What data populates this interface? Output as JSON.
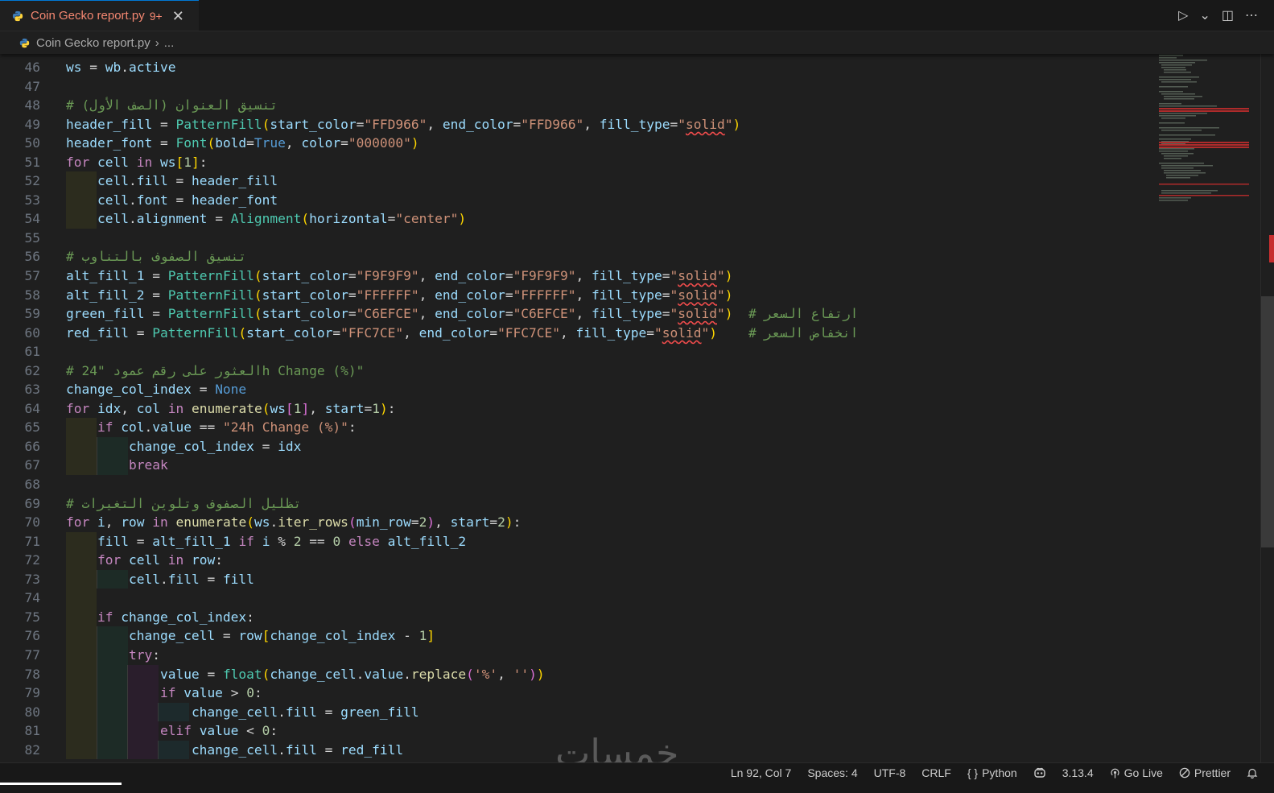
{
  "tab": {
    "filename": "Coin Gecko report.py",
    "badge": "9+",
    "close": "✕"
  },
  "breadcrumb": {
    "file": "Coin Gecko report.py",
    "chevron": "›",
    "more": "..."
  },
  "actions": {
    "run": "▷",
    "run_dropdown": "⌄",
    "split": "◫",
    "more": "⋯"
  },
  "code_lines": [
    "46",
    "47",
    "48",
    "49",
    "50",
    "51",
    "52",
    "53",
    "54",
    "55",
    "56",
    "57",
    "58",
    "59",
    "60",
    "61",
    "62",
    "63",
    "64",
    "65",
    "66",
    "67",
    "68",
    "69",
    "70",
    "71",
    "72",
    "73",
    "74",
    "75",
    "76",
    "77",
    "78",
    "79",
    "80",
    "81",
    "82"
  ],
  "code": {
    "c48": "# تنسيق العنوان (الصف الأول)",
    "c56": "# تنسيق الصفوف بالتناوب",
    "c59": "# ارتفاع السعر",
    "c60": "# انخفاض السعر",
    "c62": "# العثور على رقم عمود \"24h Change (%)\"",
    "c69": "# تظليل الصفوف وتلوين التغيرات",
    "s_ffd966": "\"FFD966\"",
    "s_solid": "solid",
    "s_000000": "\"000000\"",
    "s_center": "\"center\"",
    "s_f9f9f9": "\"F9F9F9\"",
    "s_ffffff": "\"FFFFFF\"",
    "s_c6efce": "\"C6EFCE\"",
    "s_ffc7ce": "\"FFC7CE\"",
    "s_24h": "\"24h Change (%)\"",
    "s_pct": "'%'",
    "s_empty": "''"
  },
  "statusbar": {
    "position": "Ln 92, Col 7",
    "spaces": "Spaces: 4",
    "encoding": "UTF-8",
    "eol": "CRLF",
    "language": "Python",
    "language_icon": "{ }",
    "version": "3.13.4",
    "golive": "Go Live",
    "prettier": "Prettier"
  },
  "watermark": "خمسات"
}
